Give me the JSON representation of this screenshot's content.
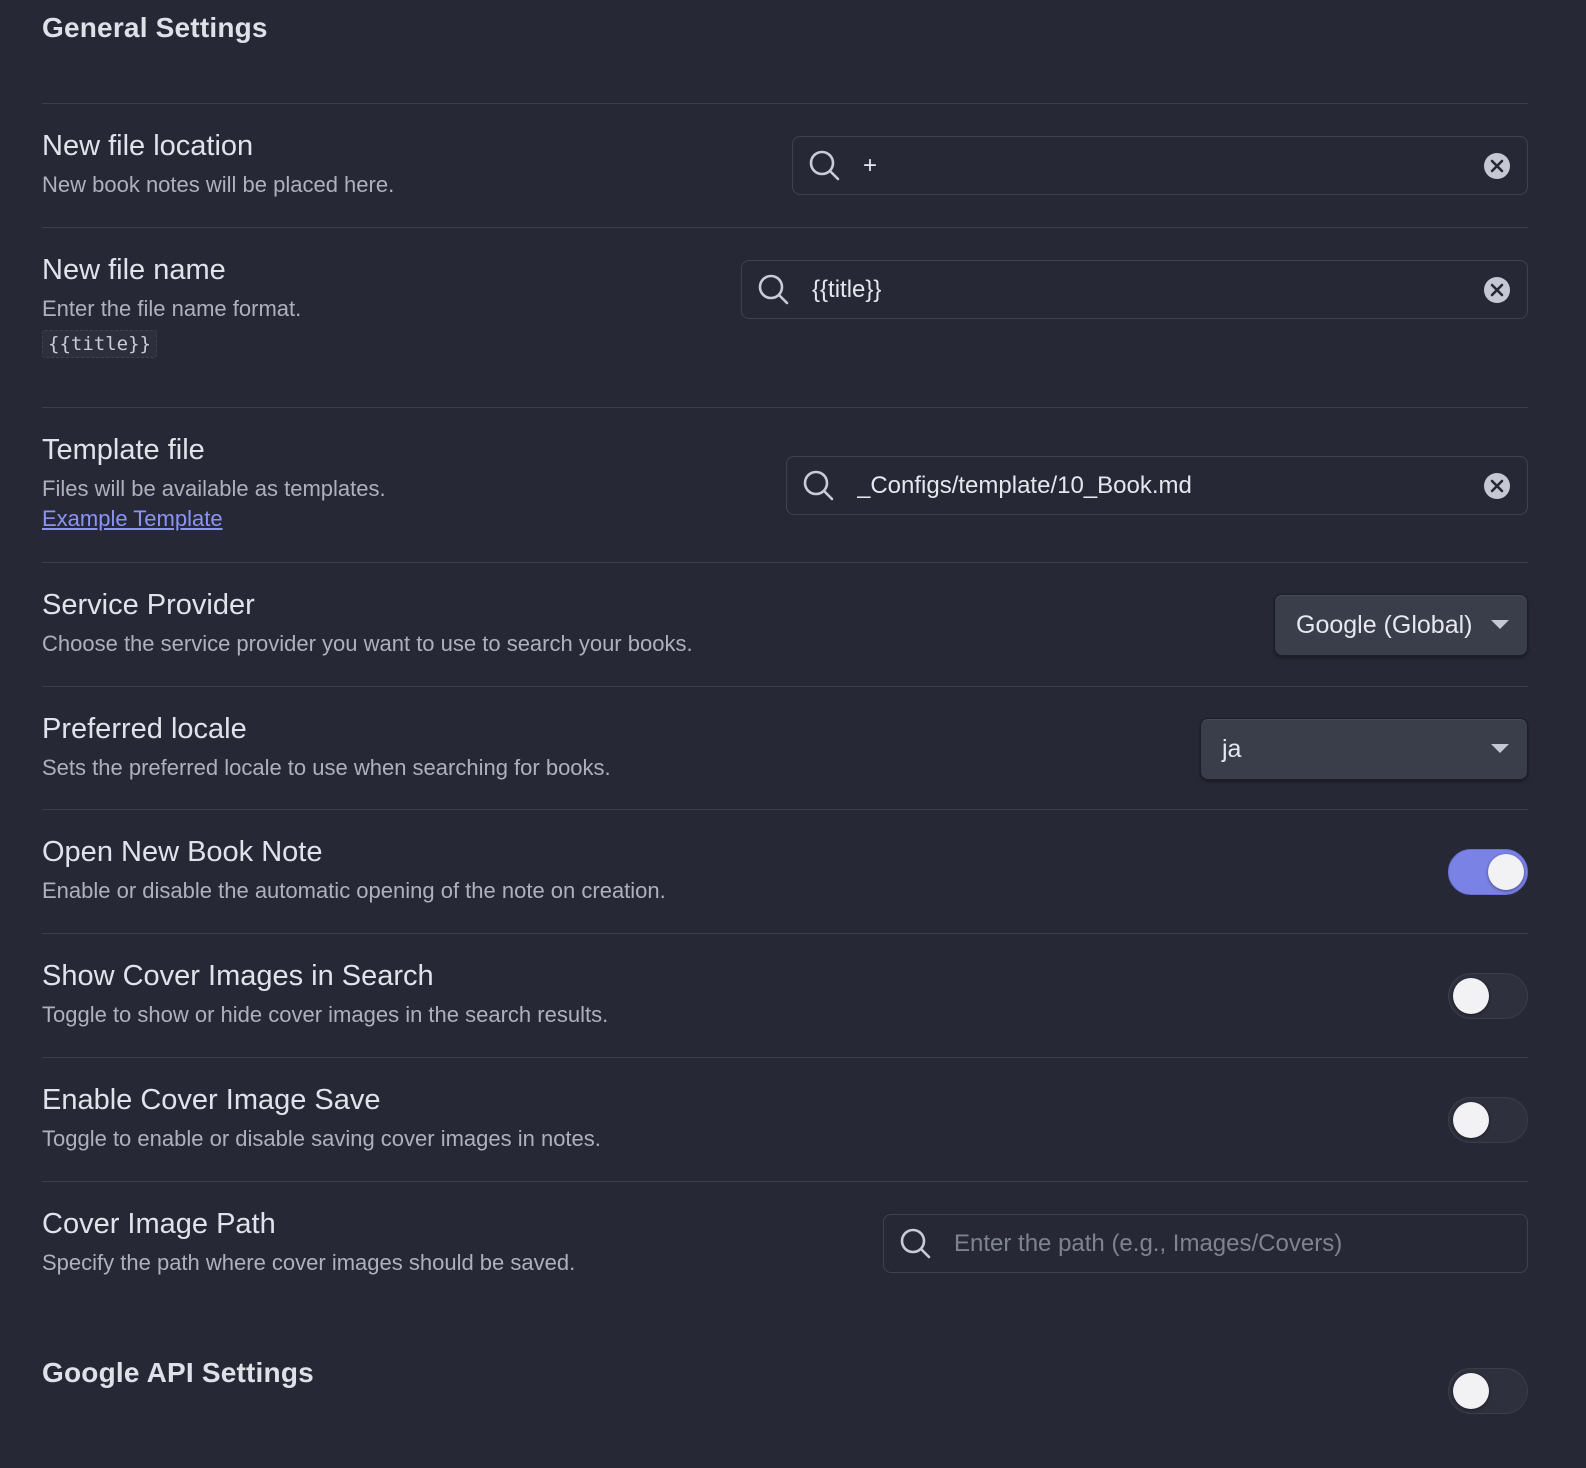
{
  "general": {
    "heading": "General Settings"
  },
  "settings": {
    "file_location": {
      "name": "New file location",
      "desc": "New book notes will be placed here.",
      "value": "+"
    },
    "file_name": {
      "name": "New file name",
      "desc": "Enter the file name format.",
      "preview": "{{title}}",
      "value": "{{title}}"
    },
    "template_file": {
      "name": "Template file",
      "desc": "Files will be available as templates.",
      "link": "Example Template",
      "value": "_Configs/template/10_Book.md"
    },
    "service_provider": {
      "name": "Service Provider",
      "desc": "Choose the service provider you want to use to search your books.",
      "selected": "Google (Global)"
    },
    "preferred_locale": {
      "name": "Preferred locale",
      "desc": "Sets the preferred locale to use when searching for books.",
      "selected": "ja"
    },
    "open_new_note": {
      "name": "Open New Book Note",
      "desc": "Enable or disable the automatic opening of the note on creation.",
      "enabled": true
    },
    "show_cover": {
      "name": "Show Cover Images in Search",
      "desc": "Toggle to show or hide cover images in the search results.",
      "enabled": false
    },
    "cover_save": {
      "name": "Enable Cover Image Save",
      "desc": "Toggle to enable or disable saving cover images in notes.",
      "enabled": false
    },
    "cover_path": {
      "name": "Cover Image Path",
      "desc": "Specify the path where cover images should be saved.",
      "placeholder": "Enter the path (e.g., Images/Covers)",
      "value": ""
    }
  },
  "google_api": {
    "heading": "Google API Settings",
    "enabled": false
  },
  "colors": {
    "background": "#262935",
    "accent": "#7b82e6",
    "link": "#8b93f5",
    "divider": "#3b3e4b"
  },
  "icons": {
    "search": "search-icon",
    "clear": "clear-icon",
    "dropdown": "chevron-down-icon"
  }
}
